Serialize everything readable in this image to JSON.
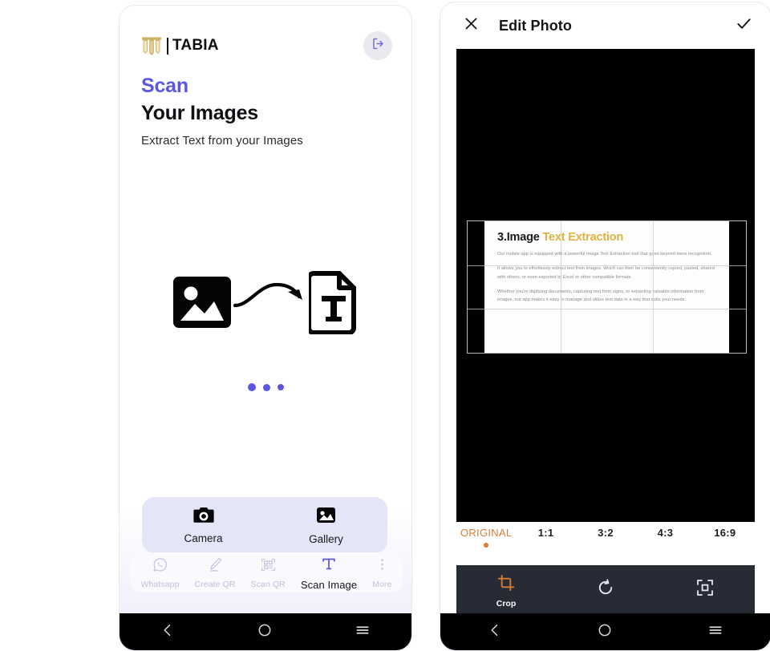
{
  "left_phone": {
    "brand": {
      "logo_icon": "tabia-pillar-logo",
      "name": "TABIA"
    },
    "logout_button": {
      "icon": "logout-icon",
      "accent": "#5b57e0"
    },
    "headings": {
      "line1": "Scan",
      "line2": "Your Images",
      "description": "Extract Text from your Images",
      "accent": "#5b57e0"
    },
    "illustration": {
      "source_icon": "image-icon",
      "arrow_icon": "curved-arrow-icon",
      "target_icon": "text-document-icon",
      "loading_dots": 3,
      "dot_color": "#5b57e0"
    },
    "picker": {
      "background": "#e4e5f6",
      "options": [
        {
          "label": "Camera",
          "icon": "camera-icon"
        },
        {
          "label": "Gallery",
          "icon": "gallery-image-icon"
        }
      ]
    },
    "tabbar": {
      "items": [
        {
          "label": "Whatsapp",
          "icon": "whatsapp-icon",
          "active": false
        },
        {
          "label": "Create QR",
          "icon": "pencil-icon",
          "active": false
        },
        {
          "label": "Scan QR",
          "icon": "qr-scan-icon",
          "active": false
        },
        {
          "label": "Scan Image",
          "icon": "text-t-icon",
          "active": true
        },
        {
          "label": "More",
          "icon": "more-vertical-icon",
          "active": false
        }
      ],
      "inactive_color": "#c3c0dd",
      "active_color": "#15151b"
    },
    "system_nav": {
      "back_icon": "back-chevron-icon",
      "home_icon": "home-circle-icon",
      "recents_icon": "recents-menu-icon"
    }
  },
  "right_phone": {
    "header": {
      "close_icon": "close-x-icon",
      "title": "Edit Photo",
      "confirm_icon": "check-icon"
    },
    "canvas": {
      "background": "#000000",
      "crop_frame": {
        "grid": "rule-of-thirds",
        "border_color": "#b9b9b9"
      }
    },
    "document_preview": {
      "title_dark": "3.Image",
      "title_gold": "Text Extraction",
      "gold_color": "#e0b341",
      "paragraphs": [
        "Our mobile app is equipped with a powerful Image Text Extraction tool that goes beyond mere recognition.",
        "It allows you to effortlessly extract text from images, which can then be conveniently copied, pasted, shared with others, or even exported to Excel or other compatible formats.",
        "Whether you're digitizing documents, capturing text from signs, or extracting valuable information from images, our app makes it easy to manage and utilize text data in a way that suits your needs."
      ]
    },
    "aspect_ratios": {
      "selected_color": "#d4803a",
      "dot_color": "#e07a2c",
      "options": [
        {
          "label": "ORIGINAL",
          "selected": true
        },
        {
          "label": "1:1",
          "selected": false
        },
        {
          "label": "3:2",
          "selected": false
        },
        {
          "label": "4:3",
          "selected": false
        },
        {
          "label": "16:9",
          "selected": false
        }
      ]
    },
    "edit_tools": {
      "background": "#262b35",
      "active_color": "#e07a2c",
      "items": [
        {
          "label": "Crop",
          "icon": "crop-icon",
          "active": true
        },
        {
          "label": "",
          "icon": "rotate-clockwise-icon",
          "active": false
        },
        {
          "label": "",
          "icon": "transform-scale-icon",
          "active": false
        }
      ]
    },
    "system_nav": {
      "back_icon": "back-chevron-icon",
      "home_icon": "home-circle-icon",
      "recents_icon": "recents-menu-icon"
    }
  }
}
